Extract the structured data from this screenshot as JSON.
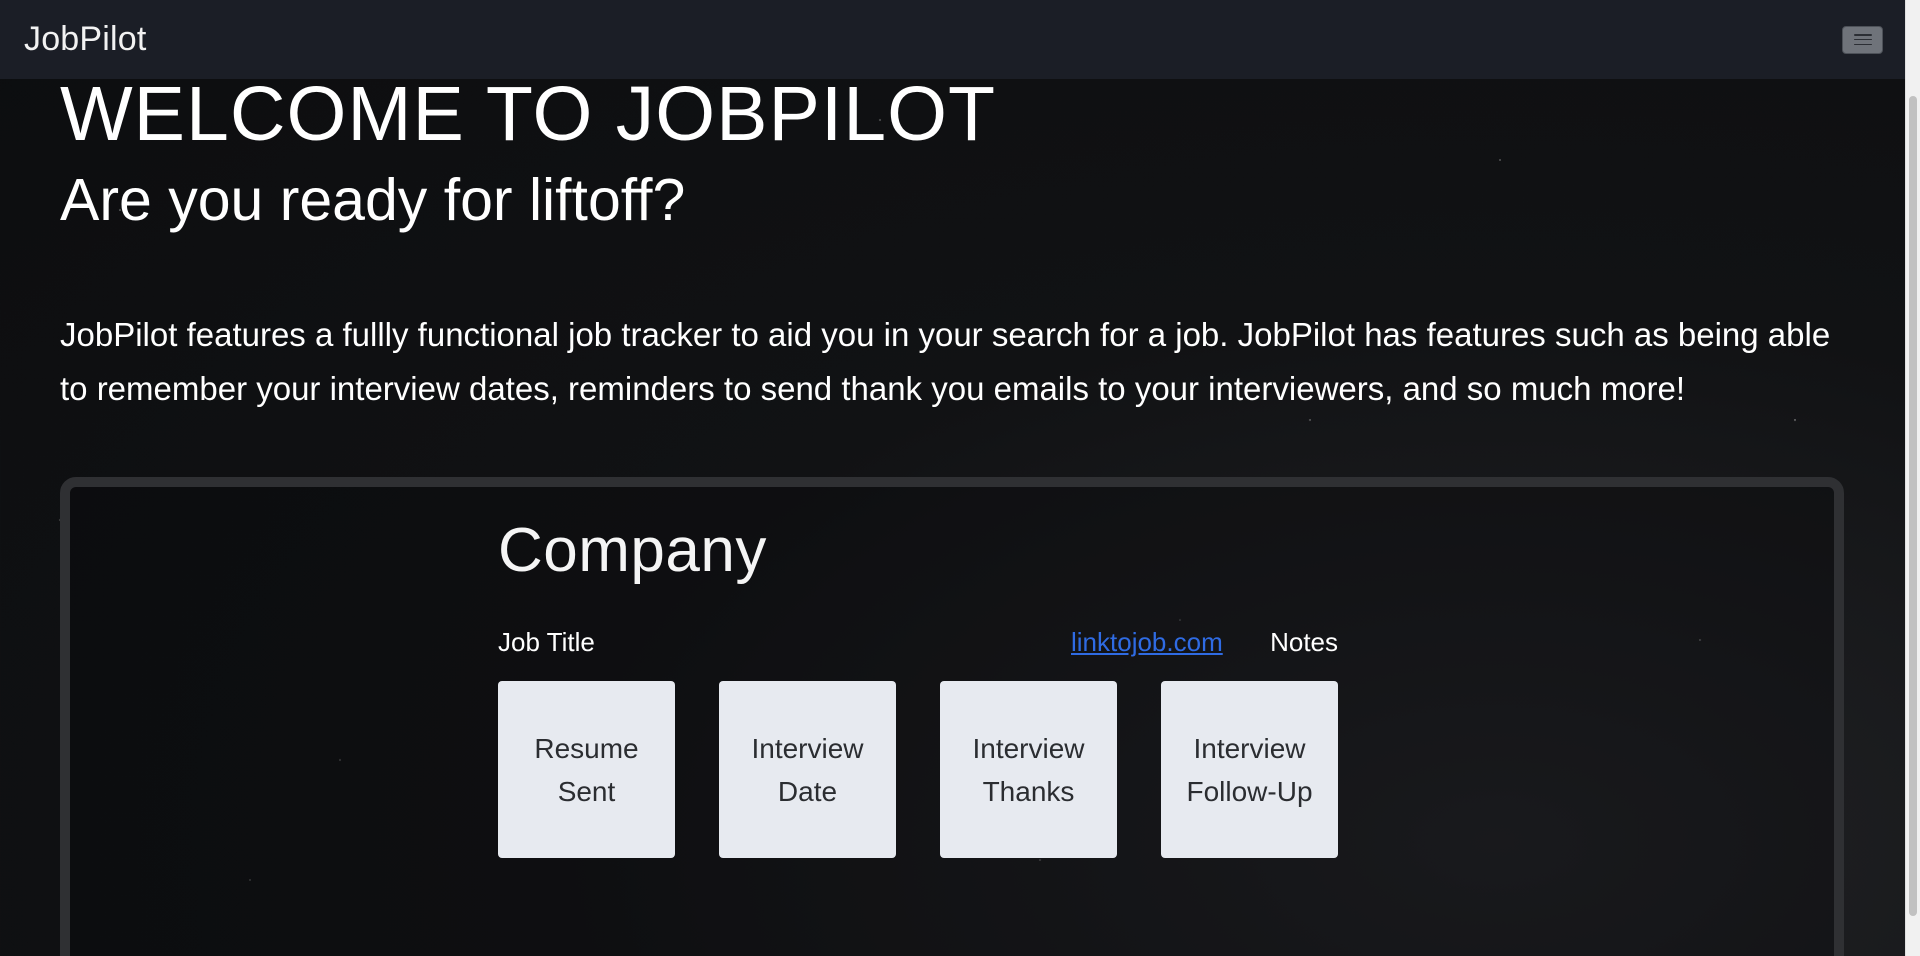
{
  "navbar": {
    "brand": "JobPilot"
  },
  "hero": {
    "title": "WELCOME TO JOBPILOT",
    "subtitle": "Are you ready for liftoff?",
    "description": "JobPilot features a fullly functional job tracker to aid you in your search for a job. JobPilot has features such as being able to remember your interview dates, reminders to send thank you emails to your interviewers, and so much more!"
  },
  "demo_card": {
    "company": "Company",
    "job_title": "Job Title",
    "link": "linktojob.com",
    "notes": "Notes",
    "tiles": [
      {
        "line1": "Resume",
        "line2": "Sent"
      },
      {
        "line1": "Interview",
        "line2": "Date"
      },
      {
        "line1": "Interview",
        "line2": "Thanks"
      },
      {
        "line1": "Interview",
        "line2": "Follow-Up"
      }
    ]
  },
  "colors": {
    "navbar_bg": "#1b1e26",
    "link": "#2f6be3",
    "tile_bg": "#e7eaf0"
  },
  "icons": {
    "menu": "hamburger-icon"
  }
}
